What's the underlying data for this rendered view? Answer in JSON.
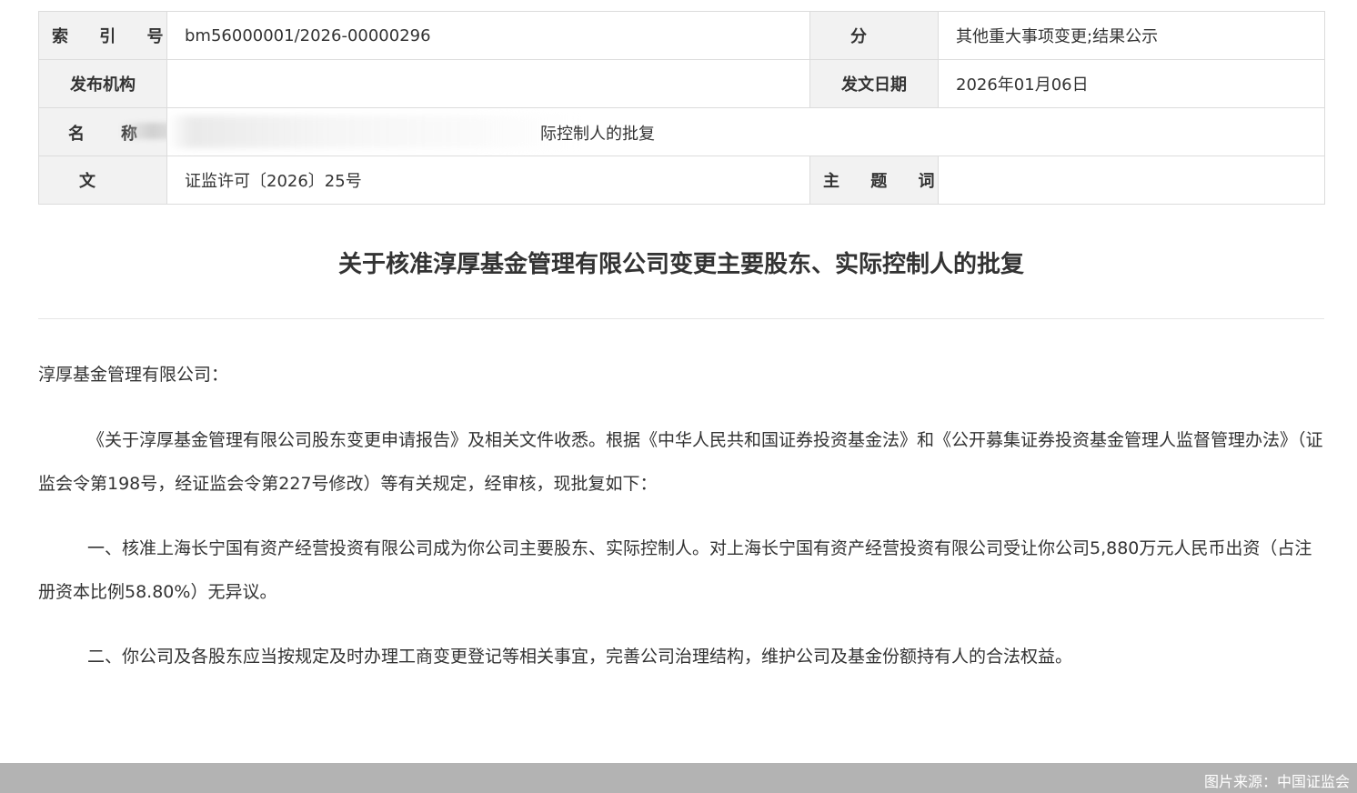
{
  "meta": {
    "index_label": "索 引 号",
    "index_value": "bm56000001/2026-00000296",
    "category_label": "分 类",
    "category_value": "其他重大事项变更;结果公示",
    "publisher_label": "发布机构",
    "publisher_value": "",
    "date_label": "发文日期",
    "date_value": "2026年01月06日",
    "name_label_1": "名",
    "name_label_2": "称",
    "name_value_visible": "际控制人的批复",
    "docno_label": "文 号",
    "docno_value": "证监许可〔2026〕25号",
    "keywords_label": "主 题 词",
    "keywords_value": ""
  },
  "document": {
    "title": "关于核准淳厚基金管理有限公司变更主要股东、实际控制人的批复",
    "salutation": "淳厚基金管理有限公司：",
    "paragraphs": [
      "《关于淳厚基金管理有限公司股东变更申请报告》及相关文件收悉。根据《中华人民共和国证券投资基金法》和《公开募集证券投资基金管理人监督管理办法》（证监会令第198号，经证监会令第227号修改）等有关规定，经审核，现批复如下：",
      "一、核准上海长宁国有资产经营投资有限公司成为你公司主要股东、实际控制人。对上海长宁国有资产经营投资有限公司受让你公司5,880万元人民币出资（占注册资本比例58.80%）无异议。",
      "二、你公司及各股东应当按规定及时办理工商变更登记等相关事宜，完善公司治理结构，维护公司及基金份额持有人的合法权益。"
    ]
  },
  "footer": {
    "source": "图片来源：中国证监会"
  },
  "colors": {
    "label_bg": "#f2f2f2",
    "border": "#dcdcdc",
    "text": "#333333",
    "footer_bg": "#b3b3b3"
  }
}
